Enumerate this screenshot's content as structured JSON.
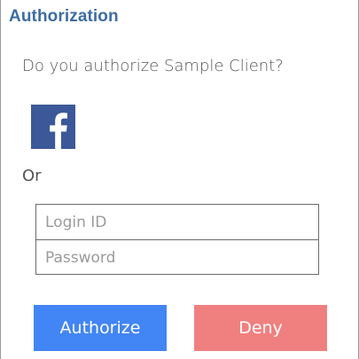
{
  "dialog": {
    "title": "Authorization",
    "question": "Do you authorize Sample Client?",
    "or_label": "Or"
  },
  "social": {
    "provider_icon": "facebook-icon",
    "color": "#3b5998"
  },
  "login": {
    "login_id": {
      "value": "",
      "placeholder": "Login ID"
    },
    "password": {
      "value": "",
      "placeholder": "Password"
    }
  },
  "actions": {
    "authorize_label": "Authorize",
    "authorize_color": "#4285f4",
    "deny_label": "Deny",
    "deny_color": "#f08080"
  },
  "colors": {
    "title": "#3d6da3",
    "text": "#555555"
  }
}
